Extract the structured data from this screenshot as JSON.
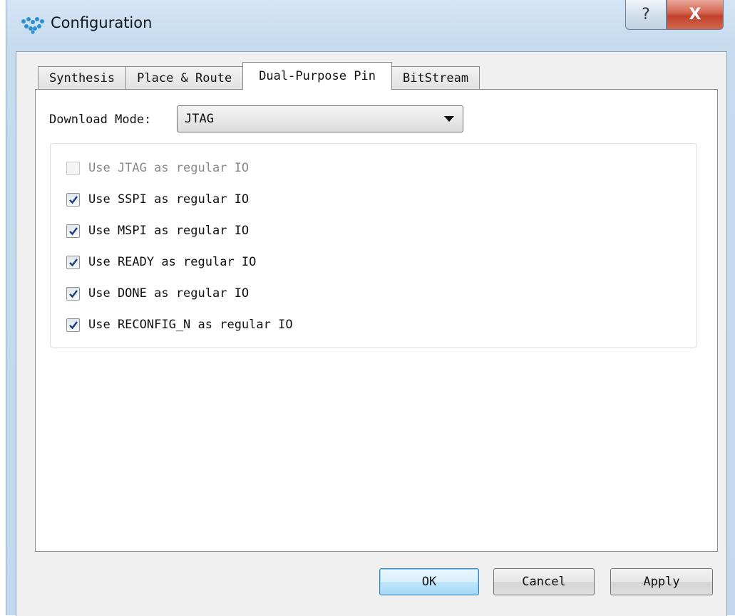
{
  "window": {
    "title": "Configuration",
    "help_glyph": "?",
    "close_glyph": "X",
    "accent": "#3ba7d9"
  },
  "tabs": [
    {
      "label": "Synthesis"
    },
    {
      "label": "Place & Route"
    },
    {
      "label": "Dual-Purpose Pin"
    },
    {
      "label": "BitStream"
    }
  ],
  "active_tab": "Dual-Purpose Pin",
  "download_mode": {
    "label": "Download Mode:",
    "value": "JTAG"
  },
  "options": [
    {
      "label": "Use JTAG as regular IO",
      "checked": false,
      "disabled": true
    },
    {
      "label": "Use SSPI as regular IO",
      "checked": true,
      "disabled": false
    },
    {
      "label": "Use MSPI as regular IO",
      "checked": true,
      "disabled": false
    },
    {
      "label": "Use READY as regular IO",
      "checked": true,
      "disabled": false
    },
    {
      "label": "Use DONE as regular IO",
      "checked": true,
      "disabled": false
    },
    {
      "label": "Use RECONFIG_N as regular IO",
      "checked": true,
      "disabled": false
    }
  ],
  "buttons": {
    "ok": "OK",
    "cancel": "Cancel",
    "apply": "Apply"
  },
  "icons": {
    "logo": "gowin-logo-icon",
    "help": "help-icon",
    "close": "close-icon",
    "dropdown": "chevron-down-icon",
    "check": "checkmark-icon"
  }
}
